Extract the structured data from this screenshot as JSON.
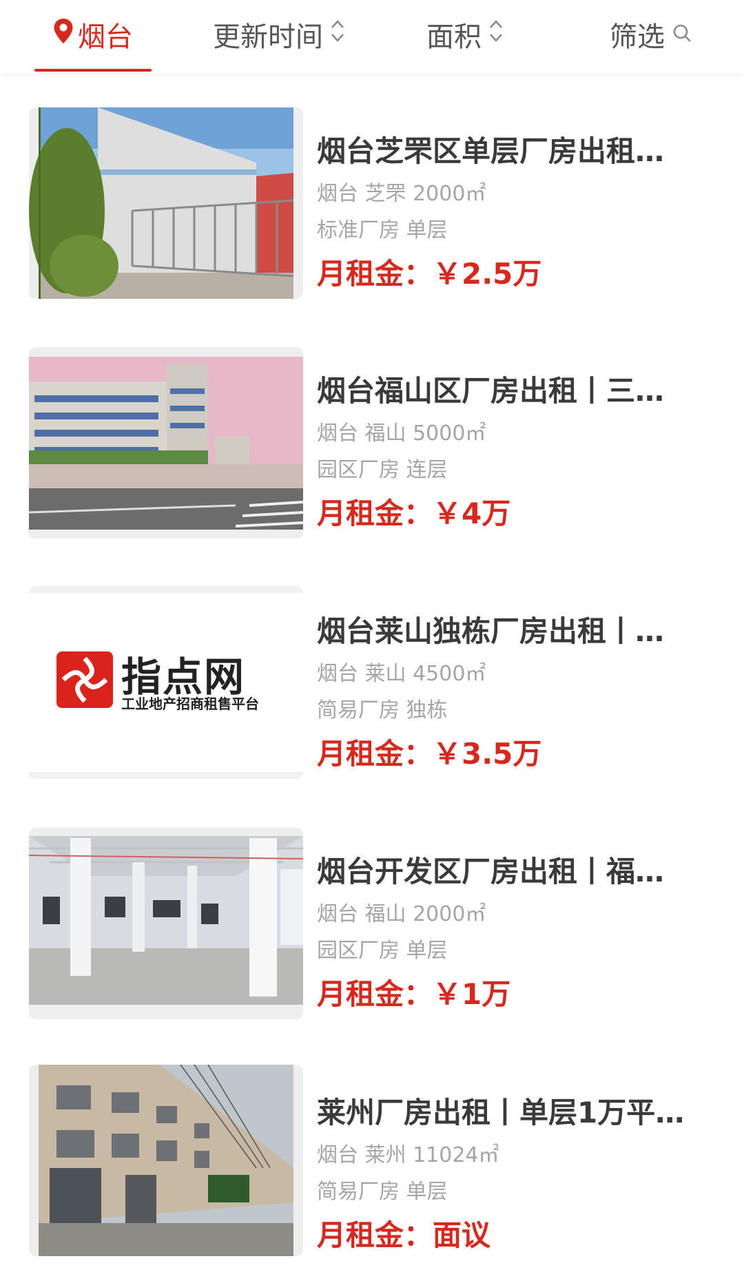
{
  "filters": {
    "city": "烟台",
    "update_time": "更新时间",
    "area": "面积",
    "filter": "筛选"
  },
  "colors": {
    "accent": "#d7281e",
    "title": "#3a3a3a",
    "meta": "#a5a5a5"
  },
  "listings": [
    {
      "title": "烟台芝罘区单层厂房出租…",
      "location": "烟台 芝罘 2000㎡",
      "type": "标准厂房 单层",
      "price": "月租金：￥2.5万",
      "image": "gated-factory-photo"
    },
    {
      "title": "烟台福山区厂房出租丨三…",
      "location": "烟台 福山 5000㎡",
      "type": "园区厂房 连层",
      "price": "月租金：￥4万",
      "image": "multi-story-factory-photo"
    },
    {
      "title": "烟台莱山独栋厂房出租丨…",
      "location": "烟台 莱山 4500㎡",
      "type": "简易厂房 独栋",
      "price": "月租金：￥3.5万",
      "image": "zhidianwang-logo",
      "logo": {
        "name": "指点网",
        "tagline": "工业地产招商租售平台"
      }
    },
    {
      "title": "烟台开发区厂房出租丨福…",
      "location": "烟台 福山 2000㎡",
      "type": "园区厂房 单层",
      "price": "月租金：￥1万",
      "image": "warehouse-interior-photo"
    },
    {
      "title": "莱州厂房出租丨单层1万平…",
      "location": "烟台 莱州 11024㎡",
      "type": "简易厂房 单层",
      "price": "月租金：面议",
      "image": "long-factory-building-photo"
    }
  ]
}
